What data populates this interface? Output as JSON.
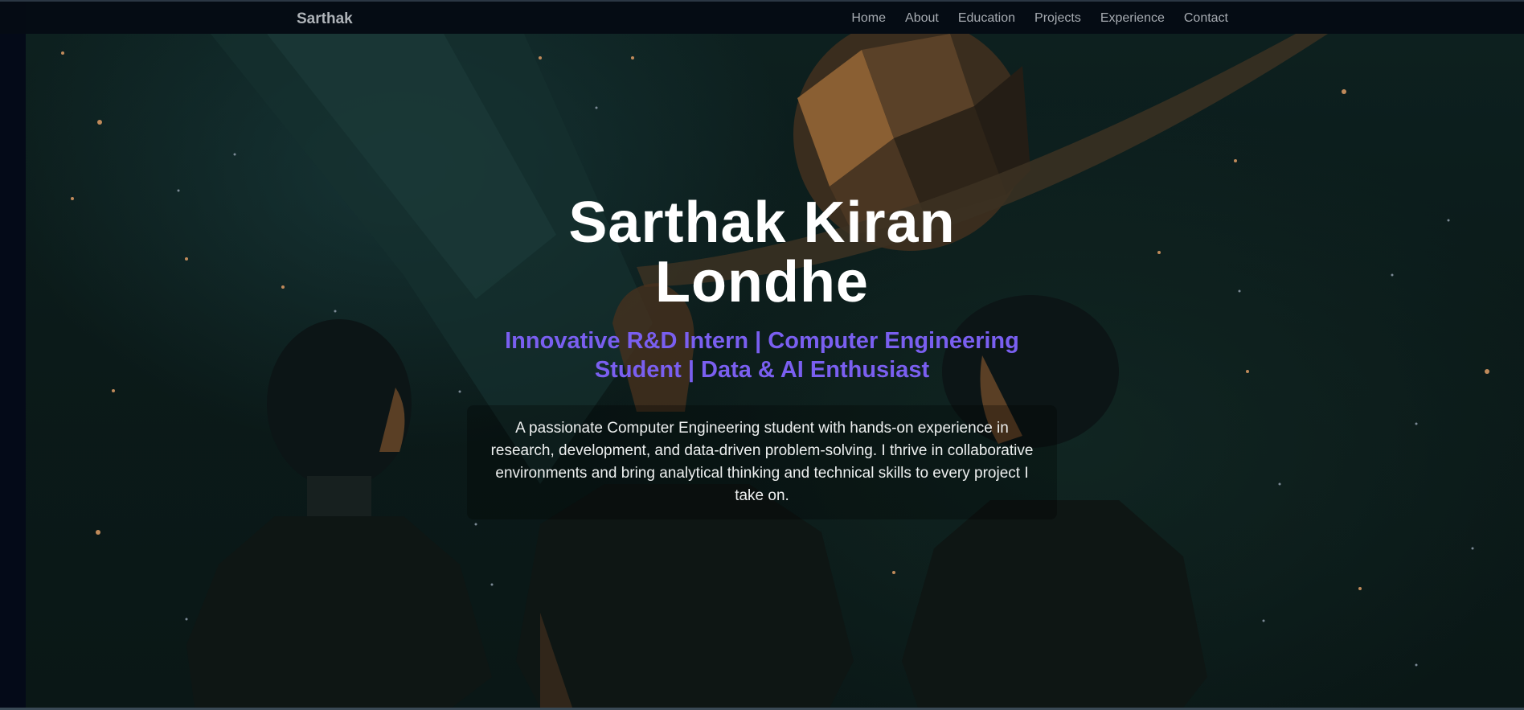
{
  "navbar": {
    "brand": "Sarthak",
    "links": [
      "Home",
      "About",
      "Education",
      "Projects",
      "Experience",
      "Contact"
    ]
  },
  "hero": {
    "title": "Sarthak Kiran Londhe",
    "subtitle": "Innovative R&D Intern | Computer Engineering Student | Data & AI Enthusiast",
    "description": "A passionate Computer Engineering student with hands-on experience in research, development, and data-driven problem-solving. I thrive in collaborative environments and bring analytical thinking and technical skills to every project I take on."
  },
  "colors": {
    "accent": "#7a5ff0",
    "background": "#0b1a19",
    "navbar": "#050c14",
    "planet": "#8a5f33"
  }
}
